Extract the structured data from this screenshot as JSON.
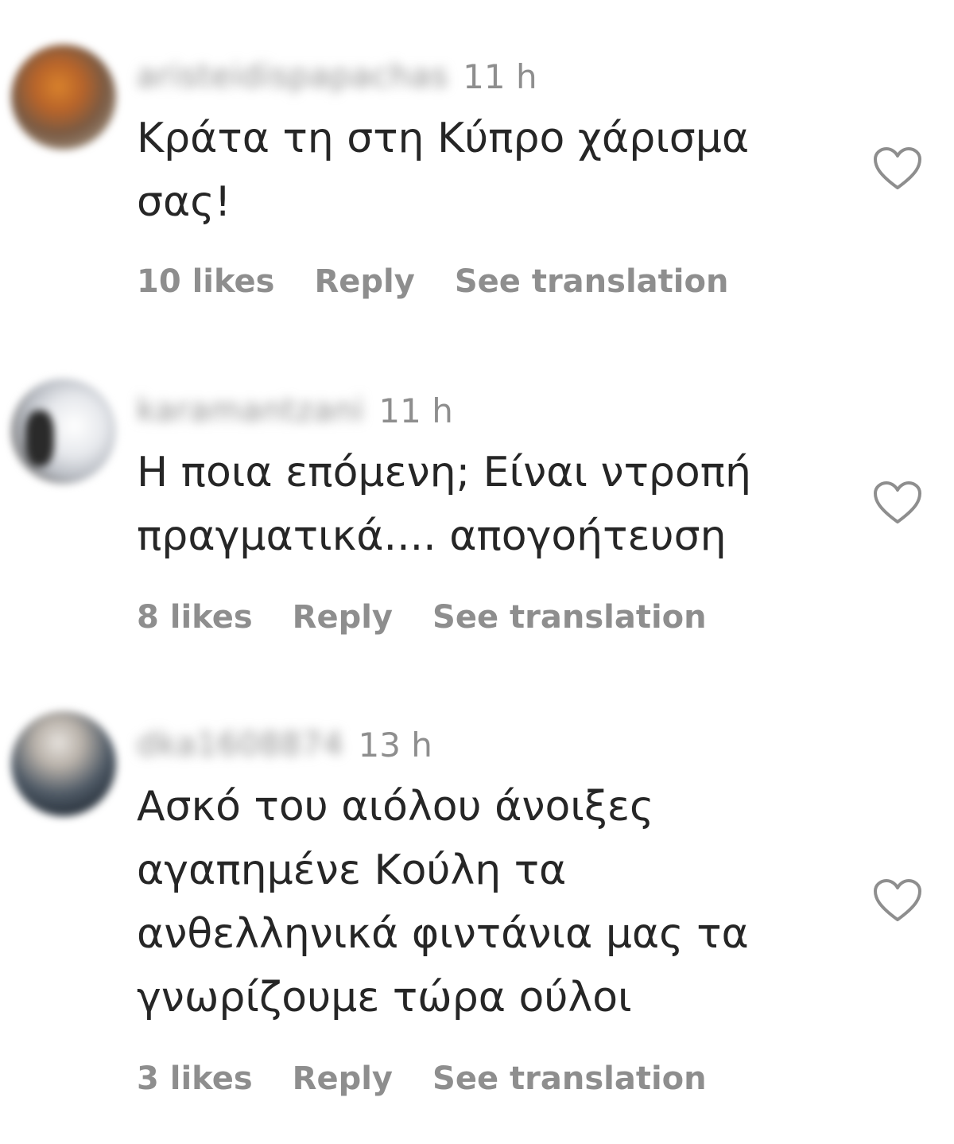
{
  "comments": [
    {
      "username": "aristeidispapachas",
      "time": "11 h",
      "text": "Κράτα τη στη Κύπρο χάρισμα\nσας!",
      "likes": "10 likes",
      "reply": "Reply",
      "translate": "See translation"
    },
    {
      "username": "karamantzani",
      "time": "11 h",
      "text": "Η ποια επόμενη; Είναι ντροπή\nπραγματικά.... απογοήτευση",
      "likes": "8 likes",
      "reply": "Reply",
      "translate": "See translation"
    },
    {
      "username": "dka1608874",
      "time": "13 h",
      "text": "Ασκό του αιόλου άνοιξες\nαγαπημένε Κούλη τα\nανθελληνικά φιντάνια μας τα\nγνωρίζουμε τώρα ούλοι",
      "likes": "3 likes",
      "reply": "Reply",
      "translate": "See translation"
    }
  ],
  "icons": {
    "avatar": "avatar",
    "like": "heart-icon"
  }
}
